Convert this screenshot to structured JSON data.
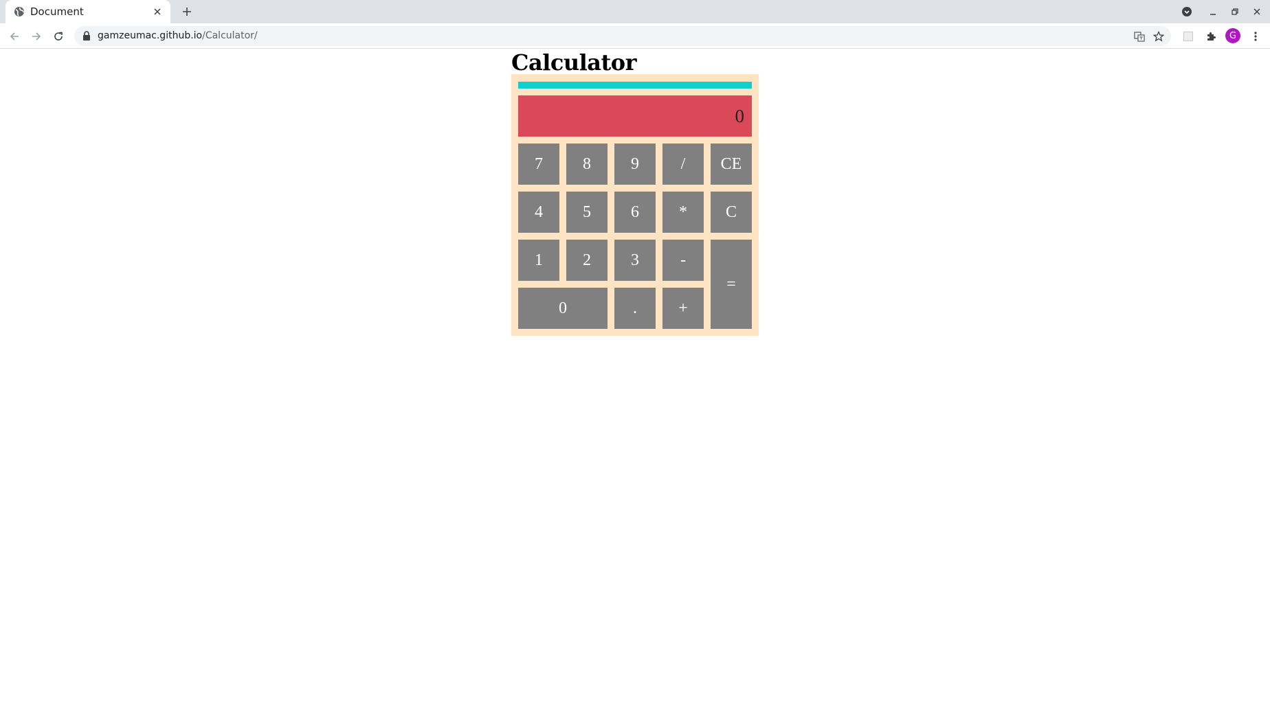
{
  "browser": {
    "tab_title": "Document",
    "url_host": "gamzeumac.github.io",
    "url_path": "/Calculator/",
    "profile_initial": "G"
  },
  "page": {
    "heading": "Calculator"
  },
  "calculator": {
    "display_value": "0",
    "history_value": "",
    "keys": {
      "k7": "7",
      "k8": "8",
      "k9": "9",
      "divide": "/",
      "ce": "CE",
      "k4": "4",
      "k5": "5",
      "k6": "6",
      "multiply": "*",
      "clear": "C",
      "k1": "1",
      "k2": "2",
      "k3": "3",
      "minus": "-",
      "equals": "=",
      "k0": "0",
      "dot": ".",
      "plus": "+"
    }
  },
  "colors": {
    "calculator_bg": "#ffe4c4",
    "history_bar": "#0fcfcf",
    "display_bg": "#d9495a",
    "key_bg": "#808080",
    "key_text": "#ffffff",
    "avatar": "#b016c2"
  }
}
